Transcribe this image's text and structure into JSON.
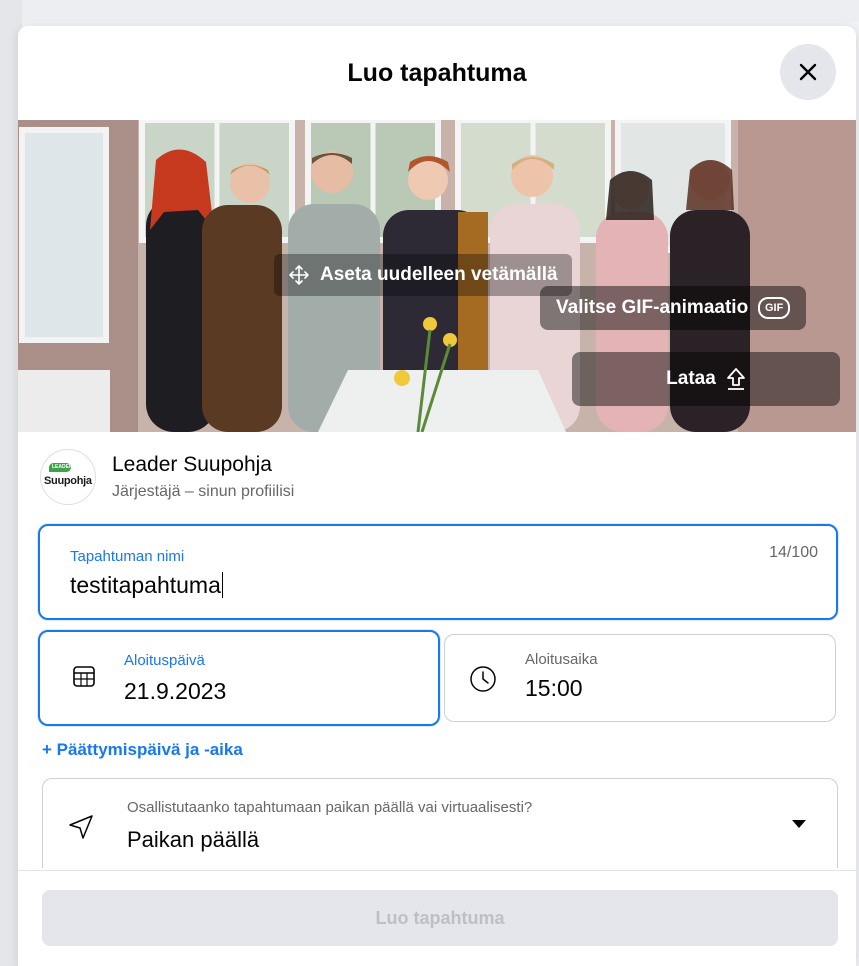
{
  "dialog": {
    "title": "Luo tapahtuma"
  },
  "cover": {
    "reposition_label": "Aseta uudelleen vetämällä",
    "gif_label": "Valitse GIF-animaatio",
    "gif_badge": "GIF",
    "upload_label": "Lataa"
  },
  "organizer": {
    "logo_text": "Suupohja",
    "logo_leaf_text": "LEADER",
    "name": "Leader Suupohja",
    "subtitle": "Järjestäjä – sinun profiilisi"
  },
  "event_name": {
    "label": "Tapahtuman nimi",
    "value": "testitapahtuma",
    "counter": "14/100"
  },
  "start_date": {
    "label": "Aloituspäivä",
    "value": "21.9.2023"
  },
  "start_time": {
    "label": "Aloitusaika",
    "value": "15:00"
  },
  "add_end_label": "+ Päättymispäivä ja -aika",
  "location": {
    "question": "Osallistutaanko tapahtumaan paikan päällä vai virtuaalisesti?",
    "value": "Paikan päällä"
  },
  "create_button": "Luo tapahtuma",
  "colors": {
    "accent": "#1877f2",
    "disabled_bg": "#e4e6eb",
    "disabled_text": "#bcc0c4"
  },
  "icons": [
    "close-icon",
    "move-arrows-icon",
    "upload-icon",
    "calendar-icon",
    "clock-icon",
    "location-arrow-icon",
    "caret-down-icon"
  ]
}
